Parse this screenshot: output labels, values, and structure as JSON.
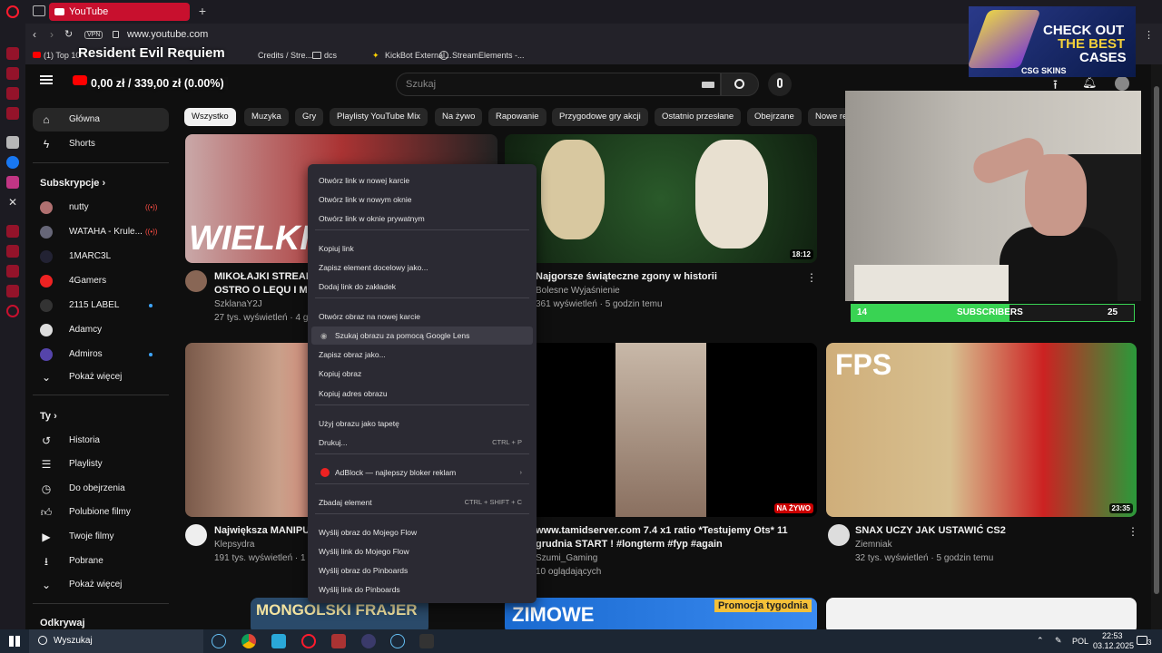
{
  "browser": {
    "tab_title": "YouTube",
    "url": "www.youtube.com",
    "vpn_label": "VPN",
    "bookmarks": [
      "(1) Top 10",
      "Credits / Stre...",
      "dcs",
      "KickBot External...",
      "StreamElements -..."
    ]
  },
  "stream_overlay": {
    "game_title": "Resident Evil Requiem",
    "ticker": "0,00 zł / 339,00 zł (0.00%)",
    "ad_line1": "CHECK OUT",
    "ad_line2": "THE BEST",
    "ad_line3": "CASES",
    "ad_brand": "CSG SKINS",
    "subs_current": "14",
    "subs_label": "SUBSCRIBERS",
    "subs_goal": "25",
    "subs_fraction": 0.56
  },
  "youtube": {
    "search_placeholder": "Szukaj",
    "sidebar": {
      "home": "Główna",
      "shorts": "Shorts",
      "subscriptions_header": "Subskrypcje",
      "channels": [
        "nutty",
        "WATAHA - Krule...",
        "1MARC3L",
        "4Gamers",
        "2115 LABEL",
        "Adamcy",
        "Admiros"
      ],
      "show_more": "Pokaż więcej",
      "you_header": "Ty",
      "you_items": [
        "Historia",
        "Playlisty",
        "Do obejrzenia",
        "Polubione filmy",
        "Twoje filmy",
        "Pobrane"
      ],
      "show_more_2": "Pokaż więcej",
      "explore_header": "Odkrywaj"
    },
    "chips": [
      "Wszystko",
      "Muzyka",
      "Gry",
      "Playlisty YouTube Mix",
      "Na żywo",
      "Rapowanie",
      "Przygodowe gry akcji",
      "Ostatnio przesłane",
      "Obejrzane",
      "Nowe re"
    ],
    "videos": [
      {
        "title": "MIKOŁAJKI STREAME",
        "title2": "OSTRO O LEQU I MAC",
        "channel": "SzklanaY2J",
        "meta": "27 tys. wyświetleń · 4 go",
        "thumb_text": "WIELKIE"
      },
      {
        "title": "Najgorsze świąteczne zgony w historii",
        "channel": "Bolesne Wyjaśnienie",
        "meta": "361 wyświetleń · 5 godzin temu",
        "duration": "18:12"
      },
      {
        "title": "Największa MANIPUL",
        "channel": "Klepsydra",
        "meta": "191 tys. wyświetleń · 1 d"
      },
      {
        "title": "www.tamidserver.com   7.4 x1 ratio  *Testujemy Ots* 11",
        "title2": "grudnia START ! #longterm #fyp #again",
        "channel": "Szumi_Gaming",
        "meta": "10 oglądających",
        "live": "NA ŻYWO"
      },
      {
        "title": "SNAX UCZY JAK USTAWIĆ CS2",
        "channel": "Ziemniak",
        "meta": "32 tys. wyświetleń · 5 godzin temu",
        "duration": "23:35",
        "thumb_text": "FPS"
      },
      {
        "thumb_text": "MONGOLSKI FRAJER"
      },
      {
        "thumb_text": "ZIMOWE",
        "badge": "Promocja tygodnia"
      }
    ]
  },
  "context_menu": {
    "items": [
      "Otwórz link w nowej karcie",
      "Otwórz link w nowym oknie",
      "Otwórz link w oknie prywatnym",
      "Kopiuj link",
      "Zapisz element docelowy jako...",
      "Dodaj link do zakładek",
      "Otwórz obraz na nowej karcie",
      "Szukaj obrazu za pomocą Google Lens",
      "Zapisz obraz jako...",
      "Kopiuj obraz",
      "Kopiuj adres obrazu",
      "Użyj obrazu jako tapetę",
      "Drukuj...",
      "AdBlock — najlepszy bloker reklam",
      "Zbadaj element",
      "Wyślij obraz do Mojego Flow",
      "Wyślij link do Mojego Flow",
      "Wyślij obraz do Pinboards",
      "Wyślij link do Pinboards"
    ],
    "shortcut_print": "CTRL + P",
    "shortcut_inspect": "CTRL + SHIFT + C"
  },
  "taskbar": {
    "search": "Wyszukaj",
    "lang": "POL",
    "time": "22:53",
    "date": "03.12.2025",
    "notif_count": "3"
  },
  "colors": {
    "accent_red": "#ff0000",
    "live_red": "#cc0000",
    "subs_green": "#39d353"
  }
}
